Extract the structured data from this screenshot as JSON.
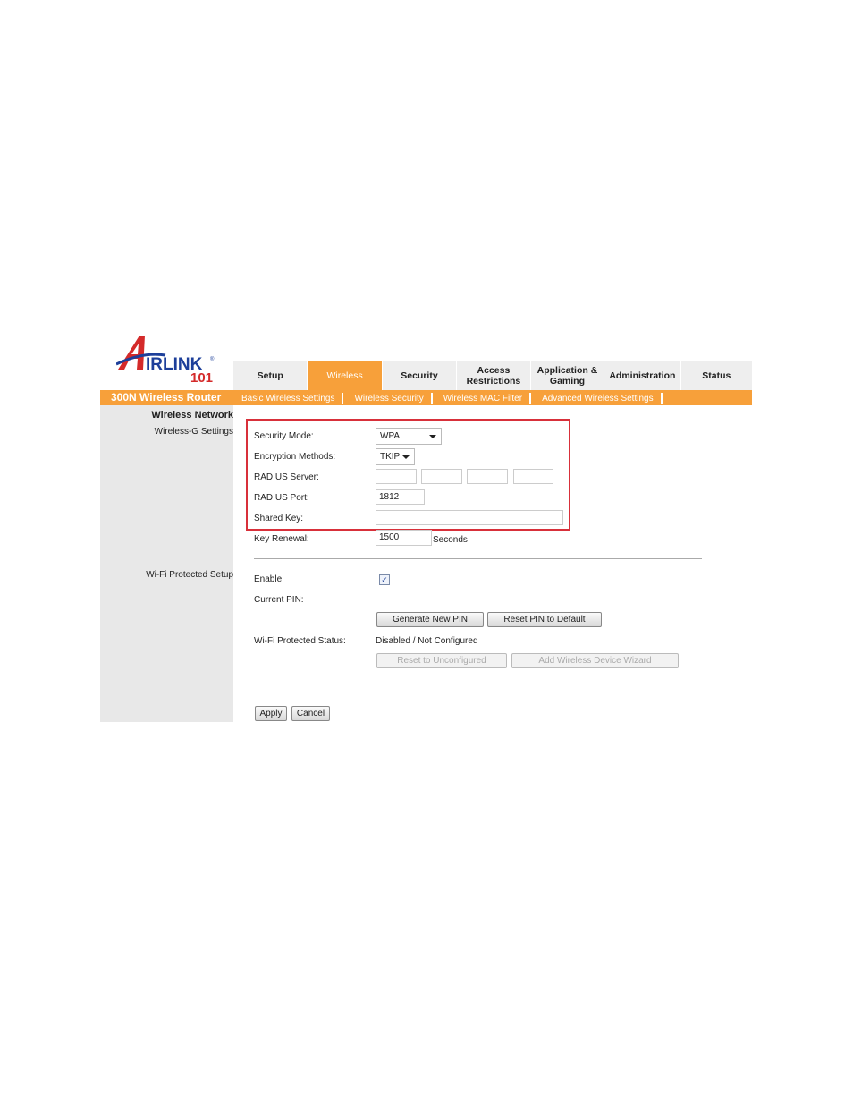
{
  "brand": {
    "name": "AirLink 101",
    "colors": {
      "red": "#d42a2a",
      "blue": "#1d3f9a",
      "orange": "#f7a03a"
    }
  },
  "nav": {
    "tabs": [
      {
        "label": "Setup"
      },
      {
        "label": "Wireless",
        "active": true
      },
      {
        "label": "Security"
      },
      {
        "label": "Access Restrictions"
      },
      {
        "label": "Application & Gaming"
      },
      {
        "label": "Administration"
      },
      {
        "label": "Status"
      }
    ]
  },
  "product": "300N Wireless Router",
  "subnav": [
    "Basic Wireless Settings",
    "Wireless Security",
    "Wireless MAC Filter",
    "Advanced Wireless Settings"
  ],
  "sidebar": {
    "section": "Wireless Network",
    "item": "Wireless-G Settings",
    "wps": "Wi-Fi Protected Setup"
  },
  "form": {
    "security_mode_label": "Security Mode:",
    "security_mode": "WPA",
    "encryption_label": "Encryption Methods:",
    "encryption": "TKIP",
    "radius_server_label": "RADIUS Server:",
    "radius_server": [
      "",
      "",
      "",
      ""
    ],
    "radius_port_label": "RADIUS Port:",
    "radius_port": "1812",
    "shared_key_label": "Shared Key:",
    "shared_key": "",
    "key_renewal_label": "Key Renewal:",
    "key_renewal": "1500",
    "key_renewal_unit": "Seconds"
  },
  "wps": {
    "enable_label": "Enable:",
    "enabled": true,
    "pin_label": "Current PIN:",
    "generate_pin": "Generate New PIN",
    "reset_pin": "Reset PIN to Default",
    "status_label": "Wi-Fi Protected Status:",
    "status": "Disabled / Not Configured",
    "reset_unconfigured": "Reset to Unconfigured",
    "add_device": "Add Wireless Device Wizard"
  },
  "actions": {
    "apply": "Apply",
    "cancel": "Cancel"
  }
}
